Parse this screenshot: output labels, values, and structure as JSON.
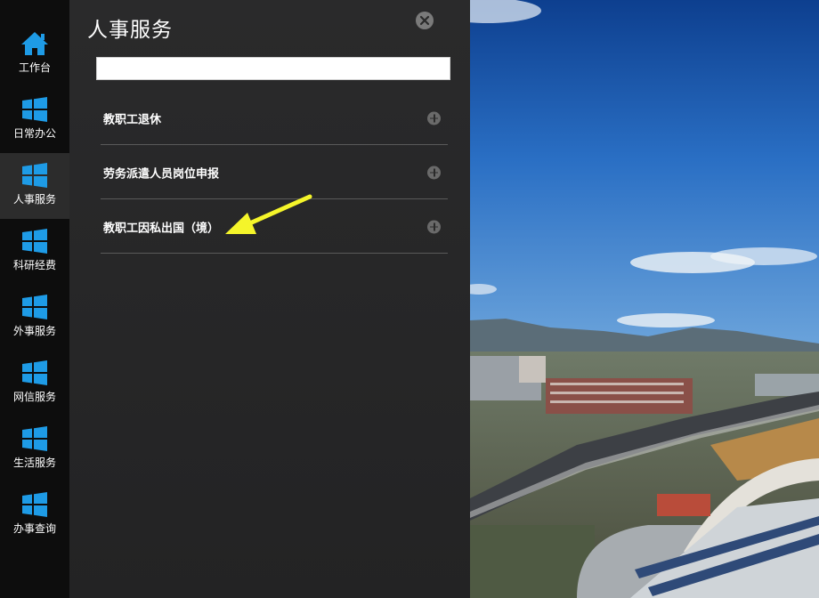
{
  "sidebar": {
    "items": [
      {
        "label": "工作台",
        "icon": "home-icon",
        "active": false
      },
      {
        "label": "日常办公",
        "icon": "windows-icon",
        "active": false
      },
      {
        "label": "人事服务",
        "icon": "windows-icon",
        "active": true
      },
      {
        "label": "科研经费",
        "icon": "windows-icon",
        "active": false
      },
      {
        "label": "外事服务",
        "icon": "windows-icon",
        "active": false
      },
      {
        "label": "网信服务",
        "icon": "windows-icon",
        "active": false
      },
      {
        "label": "生活服务",
        "icon": "windows-icon",
        "active": false
      },
      {
        "label": "办事查询",
        "icon": "windows-icon",
        "active": false
      }
    ],
    "icon_color": "#1e9be6"
  },
  "panel": {
    "title": "人事服务",
    "search": {
      "value": "",
      "placeholder": ""
    },
    "items": [
      {
        "label": "教职工退休"
      },
      {
        "label": "劳务派遣人员岗位申报"
      },
      {
        "label": "教职工因私出国（境）"
      }
    ]
  },
  "colors": {
    "accent": "#1e9be6",
    "arrow": "#f5f52a"
  }
}
